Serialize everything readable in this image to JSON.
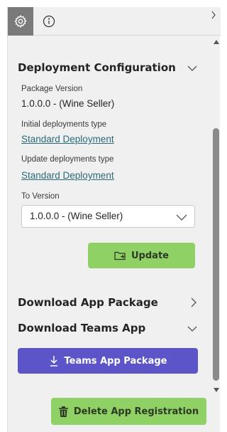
{
  "topbar": {
    "tabs": [
      {
        "name": "settings",
        "icon": "gear-icon",
        "active": true
      },
      {
        "name": "info",
        "icon": "info-icon",
        "active": false
      }
    ],
    "collapse_icon": "chevron-right-icon"
  },
  "deployment": {
    "title": "Deployment Configuration",
    "package_version_label": "Package Version",
    "package_version_value": "1.0.0.0 - (Wine Seller)",
    "initial_type_label": "Initial deployments type",
    "initial_type_value": "Standard Deployment",
    "update_type_label": "Update deployments type",
    "update_type_value": "Standard Deployment",
    "to_version_label": "To Version",
    "to_version_selected": "1.0.0.0 - (Wine Seller)",
    "update_button": "Update"
  },
  "download_app_package": {
    "title": "Download App Package"
  },
  "download_teams_app": {
    "title": "Download Teams App",
    "button": "Teams App Package"
  },
  "delete_button": "Delete App Registration",
  "colors": {
    "accent_green": "#8fd165",
    "accent_purple": "#5b55c9",
    "link": "#2b6a7a",
    "panel_bg": "#f0f0f0"
  }
}
